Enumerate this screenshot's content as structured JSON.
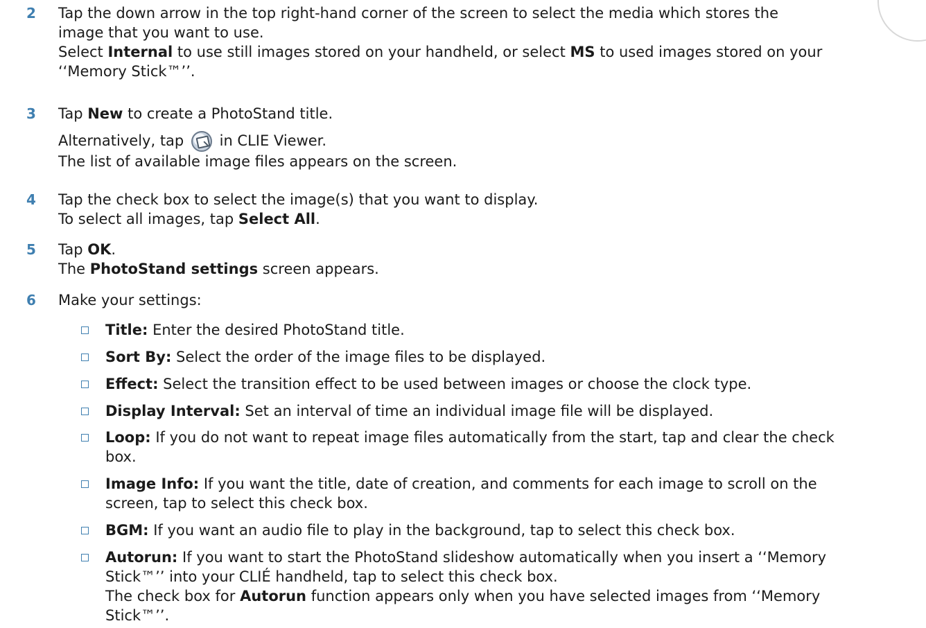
{
  "steps": [
    {
      "num": "2",
      "lines": [
        [
          "Tap the down arrow in the top right-hand corner of the screen to select the media which stores the"
        ],
        [
          "image that you want to use."
        ],
        [
          "Select ",
          "Internal",
          " to use still images stored on your handheld, or select ",
          "MS",
          " to used images stored on your"
        ],
        [
          "‘‘Memory Stick™’’."
        ]
      ]
    },
    {
      "num": "3",
      "lines": [
        [
          "Tap ",
          "New",
          " to create a PhotoStand title."
        ],
        [
          "Alternatively, tap ",
          "",
          " in CLIE Viewer."
        ],
        [
          "The list of available image files appears on the screen."
        ]
      ]
    },
    {
      "num": "4",
      "lines": [
        [
          "Tap the check box to select the image(s) that you want to display."
        ],
        [
          "To select all images, tap ",
          "Select All",
          "."
        ]
      ]
    },
    {
      "num": "5",
      "lines": [
        [
          "Tap ",
          "OK",
          "."
        ],
        [
          "The ",
          "PhotoStand settings",
          " screen appears."
        ]
      ]
    },
    {
      "num": "6",
      "lines": [
        [
          "Make your settings:"
        ]
      ]
    }
  ],
  "bullets": [
    {
      "term": "Title:",
      "lines": [
        " Enter the desired PhotoStand title."
      ]
    },
    {
      "term": "Sort By:",
      "lines": [
        " Select the order of the image files to be displayed."
      ]
    },
    {
      "term": "Effect:",
      "lines": [
        " Select the transition effect to be used between images or choose the clock type."
      ]
    },
    {
      "term": "Display Interval:",
      "lines": [
        " Set an interval of time an individual image file will be displayed."
      ]
    },
    {
      "term": "Loop:",
      "lines": [
        " If you do not want to repeat image files automatically from the start, tap and clear the check",
        "box."
      ]
    },
    {
      "term": "Image Info:",
      "lines": [
        " If you want the title, date of creation, and comments for each image to scroll on the",
        "screen, tap to select this check box."
      ]
    },
    {
      "term": "BGM:",
      "lines": [
        " If you want an audio file to play in the background, tap to select this check box."
      ]
    },
    {
      "term": "Autorun:",
      "lines": [
        " If you want to start the PhotoStand slideshow automatically when you insert a ‘‘Memory",
        "Stick™’’ into your CLIÉ handheld, tap to select this check box."
      ]
    }
  ],
  "autorun_note": {
    "line1": [
      "The check box for ",
      "Autorun",
      " function appears only when you have selected images from ‘‘Memory"
    ],
    "line2": [
      "Stick™’’."
    ]
  },
  "icons": {
    "inline_viewer_icon": "photostand-icon"
  }
}
